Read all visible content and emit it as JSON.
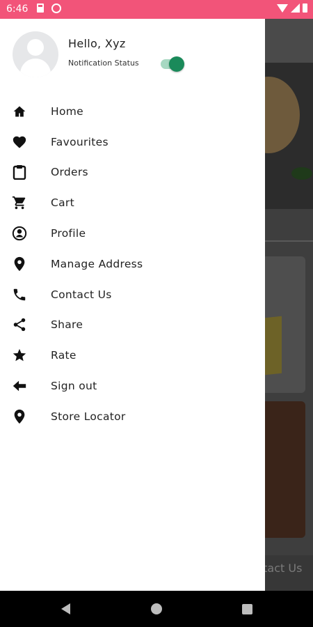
{
  "status_bar": {
    "time": "6:46"
  },
  "background_app": {
    "bottom_label": "ntact Us"
  },
  "drawer": {
    "greeting": "Hello, Xyz",
    "notification_label": "Notification Status",
    "notification_enabled": true,
    "colors": {
      "toggle_on": "#1a8a5a",
      "status_bar": "#f25479"
    },
    "menu": [
      {
        "label": "Home",
        "icon": "home-icon"
      },
      {
        "label": "Favourites",
        "icon": "heart-icon"
      },
      {
        "label": "Orders",
        "icon": "clipboard-icon"
      },
      {
        "label": "Cart",
        "icon": "cart-icon"
      },
      {
        "label": "Profile",
        "icon": "profile-icon"
      },
      {
        "label": "Manage Address",
        "icon": "location-pin-icon"
      },
      {
        "label": "Contact Us",
        "icon": "phone-icon"
      },
      {
        "label": "Share",
        "icon": "share-icon"
      },
      {
        "label": "Rate",
        "icon": "star-icon"
      },
      {
        "label": "Sign out",
        "icon": "arrow-left-icon"
      },
      {
        "label": "Store Locator",
        "icon": "location-pin-icon"
      }
    ]
  }
}
